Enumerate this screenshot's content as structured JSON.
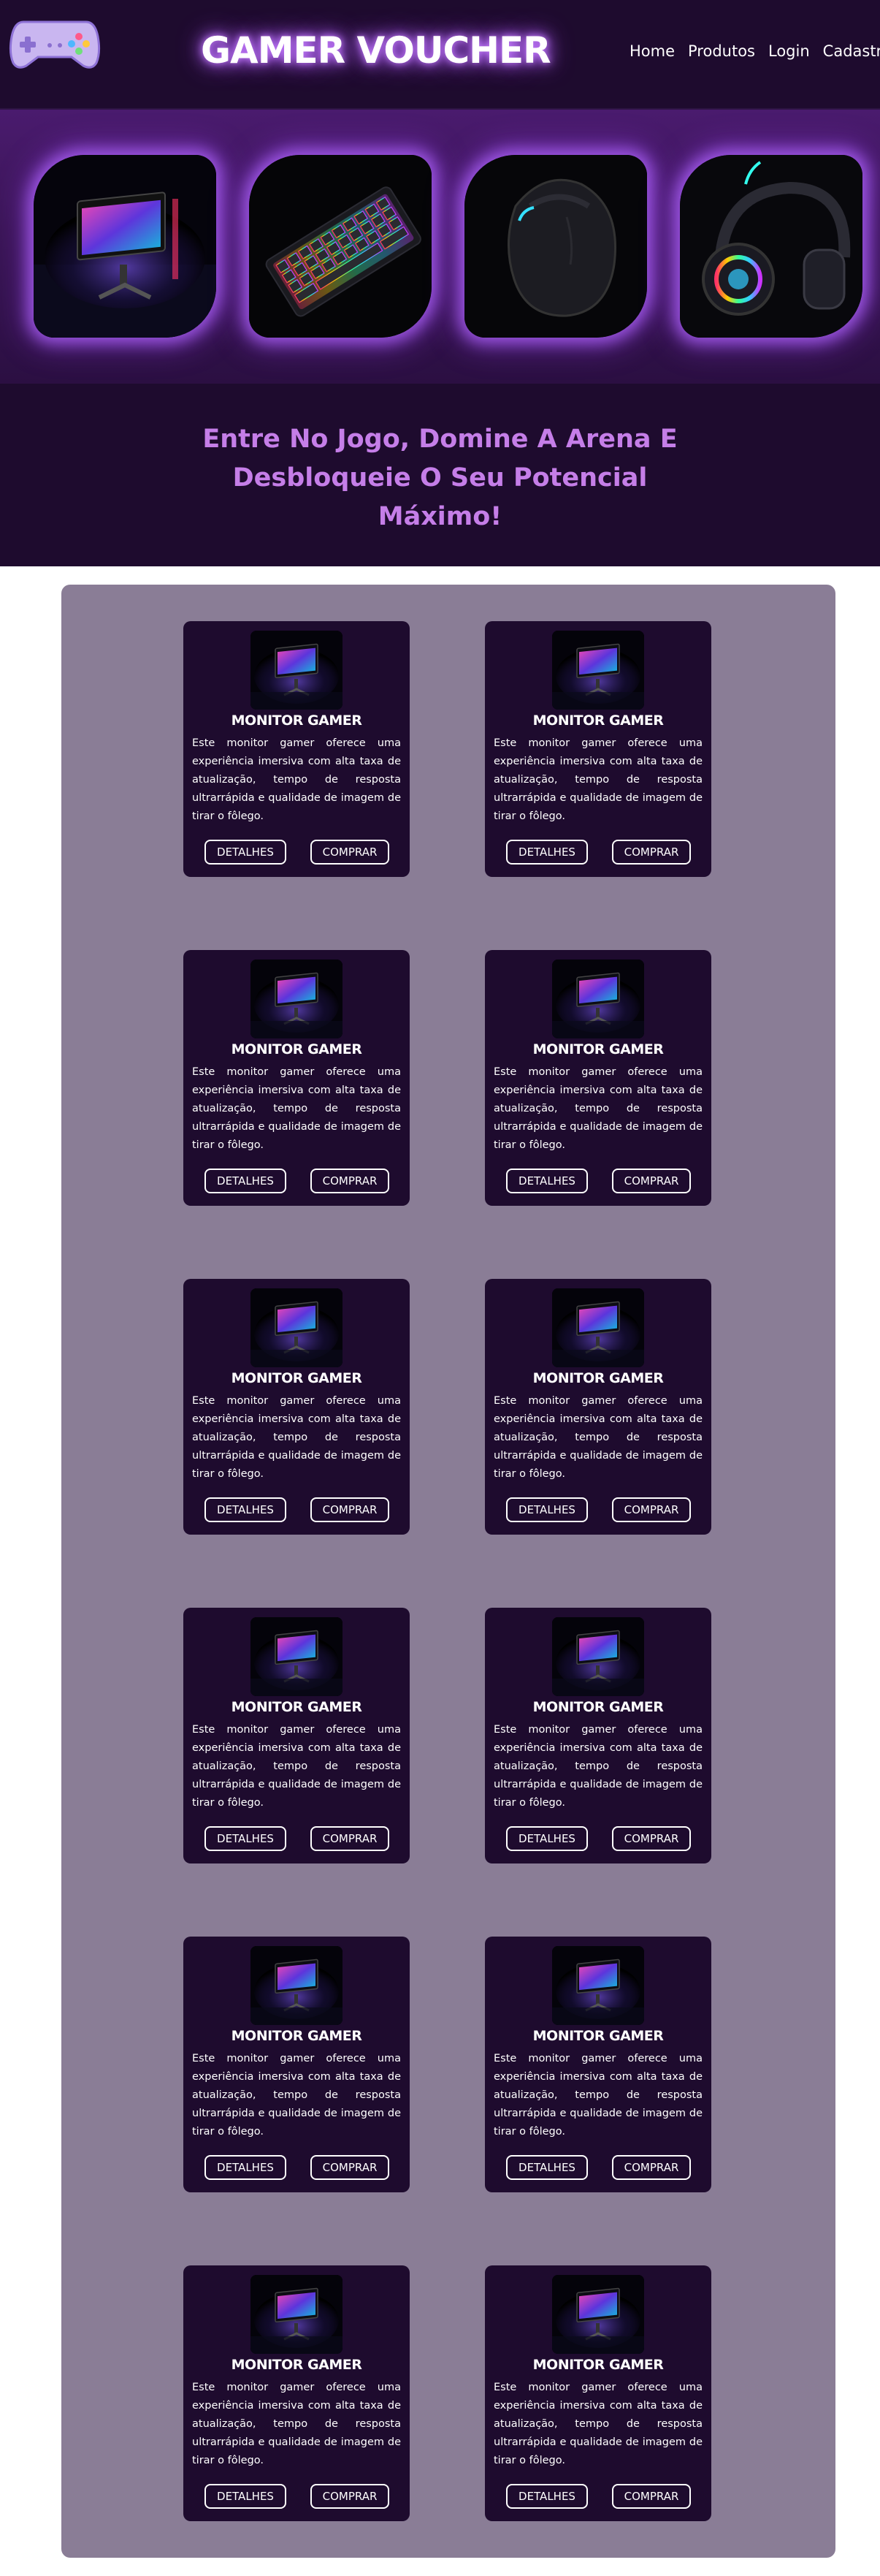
{
  "header": {
    "brand": "GAMER VOUCHER",
    "logo_icon": "gamepad-icon",
    "nav": [
      "Home",
      "Produtos",
      "Login",
      "Cadastro"
    ]
  },
  "hero": {
    "images": [
      {
        "icon": "monitor-image"
      },
      {
        "icon": "keyboard-image"
      },
      {
        "icon": "mouse-image"
      },
      {
        "icon": "headset-image"
      }
    ]
  },
  "tagline": "Entre No Jogo, Domine A Arena E Desbloqueie O Seu Potencial Máximo!",
  "products": [
    {
      "title": "MONITOR GAMER",
      "description": "Este monitor gamer oferece uma experiência imersiva com alta taxa de atualização, tempo de resposta ultrarrápida e qualidade de imagem de tirar o fôlego.",
      "details_label": "DETALHES",
      "buy_label": "COMPRAR"
    },
    {
      "title": "MONITOR GAMER",
      "description": "Este monitor gamer oferece uma experiência imersiva com alta taxa de atualização, tempo de resposta ultrarrápida e qualidade de imagem de tirar o fôlego.",
      "details_label": "DETALHES",
      "buy_label": "COMPRAR"
    },
    {
      "title": "MONITOR GAMER",
      "description": "Este monitor gamer oferece uma experiência imersiva com alta taxa de atualização, tempo de resposta ultrarrápida e qualidade de imagem de tirar o fôlego.",
      "details_label": "DETALHES",
      "buy_label": "COMPRAR"
    },
    {
      "title": "MONITOR GAMER",
      "description": "Este monitor gamer oferece uma experiência imersiva com alta taxa de atualização, tempo de resposta ultrarrápida e qualidade de imagem de tirar o fôlego.",
      "details_label": "DETALHES",
      "buy_label": "COMPRAR"
    },
    {
      "title": "MONITOR GAMER",
      "description": "Este monitor gamer oferece uma experiência imersiva com alta taxa de atualização, tempo de resposta ultrarrápida e qualidade de imagem de tirar o fôlego.",
      "details_label": "DETALHES",
      "buy_label": "COMPRAR"
    },
    {
      "title": "MONITOR GAMER",
      "description": "Este monitor gamer oferece uma experiência imersiva com alta taxa de atualização, tempo de resposta ultrarrápida e qualidade de imagem de tirar o fôlego.",
      "details_label": "DETALHES",
      "buy_label": "COMPRAR"
    },
    {
      "title": "MONITOR GAMER",
      "description": "Este monitor gamer oferece uma experiência imersiva com alta taxa de atualização, tempo de resposta ultrarrápida e qualidade de imagem de tirar o fôlego.",
      "details_label": "DETALHES",
      "buy_label": "COMPRAR"
    },
    {
      "title": "MONITOR GAMER",
      "description": "Este monitor gamer oferece uma experiência imersiva com alta taxa de atualização, tempo de resposta ultrarrápida e qualidade de imagem de tirar o fôlego.",
      "details_label": "DETALHES",
      "buy_label": "COMPRAR"
    },
    {
      "title": "MONITOR GAMER",
      "description": "Este monitor gamer oferece uma experiência imersiva com alta taxa de atualização, tempo de resposta ultrarrápida e qualidade de imagem de tirar o fôlego.",
      "details_label": "DETALHES",
      "buy_label": "COMPRAR"
    },
    {
      "title": "MONITOR GAMER",
      "description": "Este monitor gamer oferece uma experiência imersiva com alta taxa de atualização, tempo de resposta ultrarrápida e qualidade de imagem de tirar o fôlego.",
      "details_label": "DETALHES",
      "buy_label": "COMPRAR"
    },
    {
      "title": "MONITOR GAMER",
      "description": "Este monitor gamer oferece uma experiência imersiva com alta taxa de atualização, tempo de resposta ultrarrápida e qualidade de imagem de tirar o fôlego.",
      "details_label": "DETALHES",
      "buy_label": "COMPRAR"
    },
    {
      "title": "MONITOR GAMER",
      "description": "Este monitor gamer oferece uma experiência imersiva com alta taxa de atualização, tempo de resposta ultrarrápida e qualidade de imagem de tirar o fôlego.",
      "details_label": "DETALHES",
      "buy_label": "COMPRAR"
    }
  ],
  "colors": {
    "header_bg": "#1e0b2e",
    "card_bg": "#1e0b2e",
    "section_bg": "#8a7d96",
    "tagline": "#c57ee8",
    "glow": "#b266ff"
  }
}
